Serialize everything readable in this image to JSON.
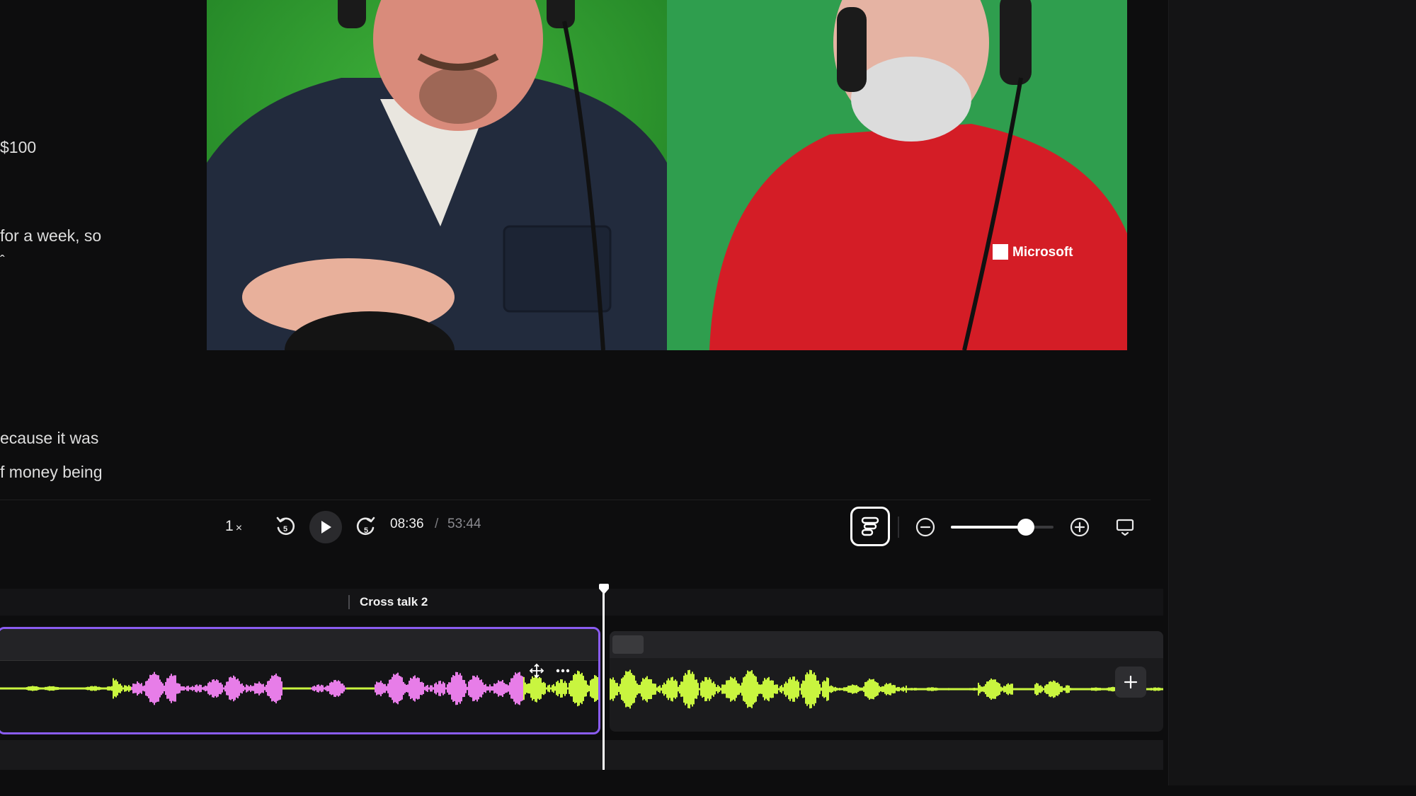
{
  "transcript": {
    "lines": [
      "$100",
      "for a week, so",
      "ˆ",
      "ecause it was",
      "f money being"
    ]
  },
  "video": {
    "right_shirt_logo": "Microsoft"
  },
  "player": {
    "speed": "1",
    "speed_suffix": "×",
    "skip_seconds": "5",
    "current_time": "08:36",
    "separator": "/",
    "total_time": "53:44",
    "zoom_level": 0.73
  },
  "timeline": {
    "marker_label": "Cross talk 2",
    "playhead_time": "08:36"
  },
  "colors": {
    "accent": "#8a5cf0",
    "waveform_green": "#c9f53f",
    "waveform_pink": "#e77de8",
    "background": "#0d0d0e"
  },
  "icons": {
    "rewind": "rewind-5-icon",
    "play": "play-icon",
    "forward": "forward-5-icon",
    "script": "script-view-icon",
    "zoom_out": "zoom-out-icon",
    "zoom_in": "zoom-in-icon",
    "display": "display-options-icon",
    "move": "move-icon",
    "more": "more-icon",
    "add": "add-icon"
  }
}
